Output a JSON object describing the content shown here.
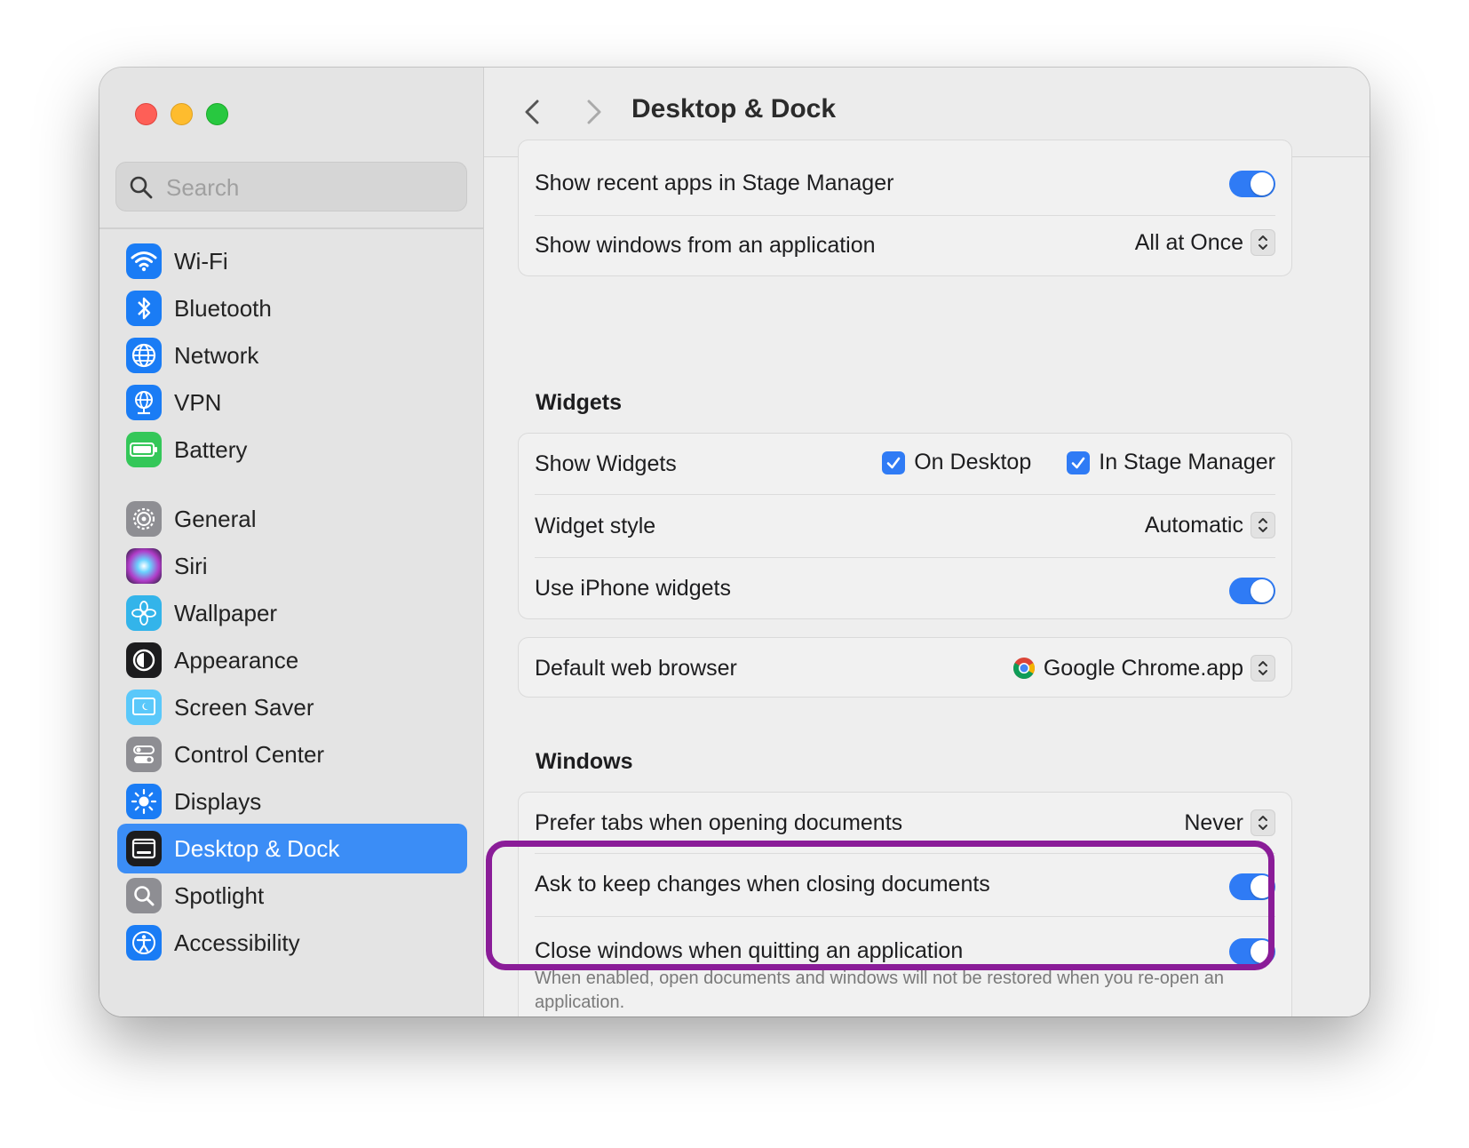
{
  "window": {
    "title": "Desktop & Dock"
  },
  "search": {
    "placeholder": "Search"
  },
  "sidebar": {
    "items": [
      {
        "label": "Wi-Fi",
        "icon": "wifi-icon",
        "color": "#1a7cf5"
      },
      {
        "label": "Bluetooth",
        "icon": "bluetooth-icon",
        "color": "#1a7cf5"
      },
      {
        "label": "Network",
        "icon": "globe-icon",
        "color": "#1a7cf5"
      },
      {
        "label": "VPN",
        "icon": "vpn-globe-icon",
        "color": "#1a7cf5"
      },
      {
        "label": "Battery",
        "icon": "battery-icon",
        "color": "#34c759"
      },
      {
        "label": "General",
        "icon": "gear-icon",
        "color": "#8e8e93"
      },
      {
        "label": "Siri",
        "icon": "siri-icon",
        "color": "#b03cc8"
      },
      {
        "label": "Wallpaper",
        "icon": "flower-icon",
        "color": "#33b4ea"
      },
      {
        "label": "Appearance",
        "icon": "appearance-icon",
        "color": "#1c1c1e"
      },
      {
        "label": "Screen Saver",
        "icon": "screen-saver-icon",
        "color": "#5ac8fa"
      },
      {
        "label": "Control Center",
        "icon": "control-center-icon",
        "color": "#8e8e93"
      },
      {
        "label": "Displays",
        "icon": "sun-icon",
        "color": "#1a7cf5"
      },
      {
        "label": "Desktop & Dock",
        "icon": "dock-icon",
        "color": "#1c1c1e",
        "selected": true
      },
      {
        "label": "Spotlight",
        "icon": "magnifier-icon",
        "color": "#8e8e93"
      },
      {
        "label": "Accessibility",
        "icon": "accessibility-icon",
        "color": "#1a7cf5"
      }
    ]
  },
  "stage": {
    "recent_apps_label": "Show recent apps in Stage Manager",
    "recent_apps_on": true,
    "show_windows_label": "Show windows from an application",
    "show_windows_value": "All at Once"
  },
  "widgets": {
    "heading": "Widgets",
    "show_label": "Show Widgets",
    "on_desktop_label": "On Desktop",
    "on_desktop_checked": true,
    "in_stage_label": "In Stage Manager",
    "in_stage_checked": true,
    "style_label": "Widget style",
    "style_value": "Automatic",
    "iphone_label": "Use iPhone widgets",
    "iphone_on": true
  },
  "browser": {
    "label": "Default web browser",
    "value": "Google Chrome.app",
    "icon": "chrome-icon"
  },
  "windows": {
    "heading": "Windows",
    "prefer_tabs_label": "Prefer tabs when opening documents",
    "prefer_tabs_value": "Never",
    "ask_keep_label": "Ask to keep changes when closing documents",
    "ask_keep_on": true,
    "close_windows_label": "Close windows when quitting an application",
    "close_windows_on": true,
    "close_windows_desc": "When enabled, open documents and windows will not be restored when you re-open an application."
  },
  "colors": {
    "accent": "#2f7bf5",
    "selection": "#3b8df6",
    "highlight_box": "#8a1c98"
  }
}
